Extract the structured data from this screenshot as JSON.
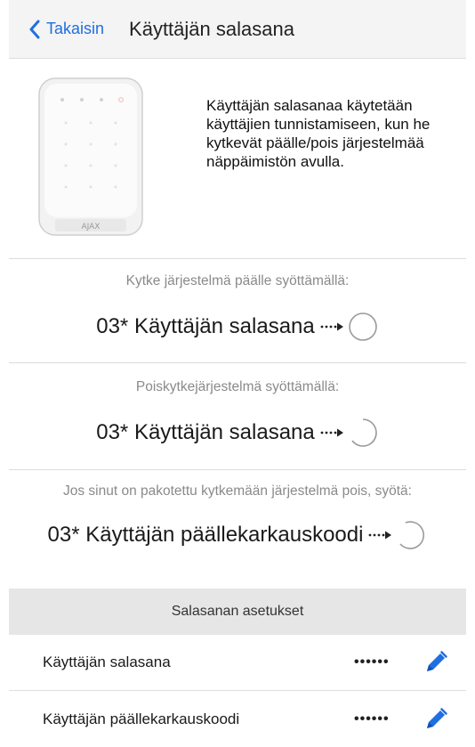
{
  "navbar": {
    "back_label": "Takaisin",
    "title": "Käyttäjän salasana"
  },
  "intro": {
    "device_brand": "AJAX",
    "description": "Käyttäjän salasanaa käytetään käyttäjien tunnistamiseen, kun he kytkevät päälle/pois järjestelmää näppäimistön avulla."
  },
  "arm": {
    "caption": "Kytke järjestelmä päälle syöttämällä:",
    "code": "03* Käyttäjän salasana"
  },
  "disarm": {
    "caption": "Poiskytkejärjestelmä syöttämällä:",
    "code": "03* Käyttäjän salasana"
  },
  "duress": {
    "caption": "Jos sinut on pakotettu kytkemään järjestelmä pois, syötä:",
    "code": "03* Käyttäjän päällekarkauskoodi"
  },
  "settings": {
    "header": "Salasanan asetukset",
    "rows": [
      {
        "label": "Käyttäjän salasana",
        "value": "••••••"
      },
      {
        "label": "Käyttäjän päällekarkauskoodi",
        "value": "••••••"
      }
    ]
  },
  "colors": {
    "accent": "#1f6fe0",
    "caption": "#8a8a8a",
    "section_bg": "#e6e6e6"
  },
  "icons": {
    "back": "chevron-left-icon",
    "arrow": "dotted-arrow-icon",
    "circle": "loading-circle-icon",
    "edit": "pencil-icon"
  }
}
